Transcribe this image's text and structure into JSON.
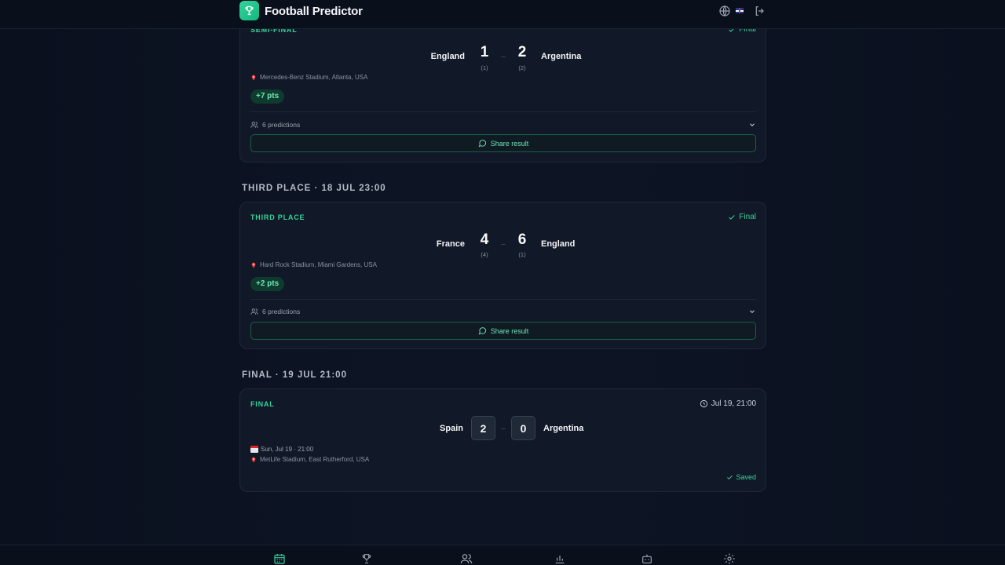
{
  "header": {
    "app_title": "Football Predictor",
    "icons": [
      "trophy-icon",
      "globe-icon",
      "uk-flag-icon",
      "logout-icon"
    ]
  },
  "sections": [
    {
      "title": "",
      "match": {
        "stage": "SEMI-FINAL",
        "status": "Final",
        "home_team": "England",
        "away_team": "Argentina",
        "home_score": "1",
        "away_score": "2",
        "home_sub": "(1)",
        "away_sub": "(2)",
        "dash": "–",
        "venue": "Mercedes-Benz Stadium, Atlanta, USA",
        "points": "+7 pts",
        "predictions": "6 predictions",
        "share_label": "Share result"
      }
    },
    {
      "title": "THIRD PLACE · 18 JUL 23:00",
      "match": {
        "stage": "THIRD PLACE",
        "status": "Final",
        "home_team": "France",
        "away_team": "England",
        "home_score": "4",
        "away_score": "6",
        "home_sub": "(4)",
        "away_sub": "(1)",
        "dash": "–",
        "venue": "Hard Rock Stadium, Miami Gardens, USA",
        "points": "+2 pts",
        "predictions": "6 predictions",
        "share_label": "Share result"
      }
    },
    {
      "title": "FINAL · 19 JUL 21:00",
      "match": {
        "stage": "FINAL",
        "status": "Jul 19, 21:00",
        "home_team": "Spain",
        "away_team": "Argentina",
        "home_input": "2",
        "away_input": "0",
        "dash": "–",
        "date_line": "Sun, Jul 19 · 21:00",
        "venue": "MetLife Stadium, East Rutherford, USA",
        "saved_label": "Saved"
      }
    }
  ],
  "bottom_nav": [
    "calendar-icon",
    "trophy-icon",
    "users-icon",
    "stats-icon",
    "bot-icon",
    "settings-icon"
  ],
  "colors": {
    "background": "#0b1120",
    "card": "#111827",
    "accent": "#34d399",
    "badge_bg": "#0f3b2e"
  }
}
